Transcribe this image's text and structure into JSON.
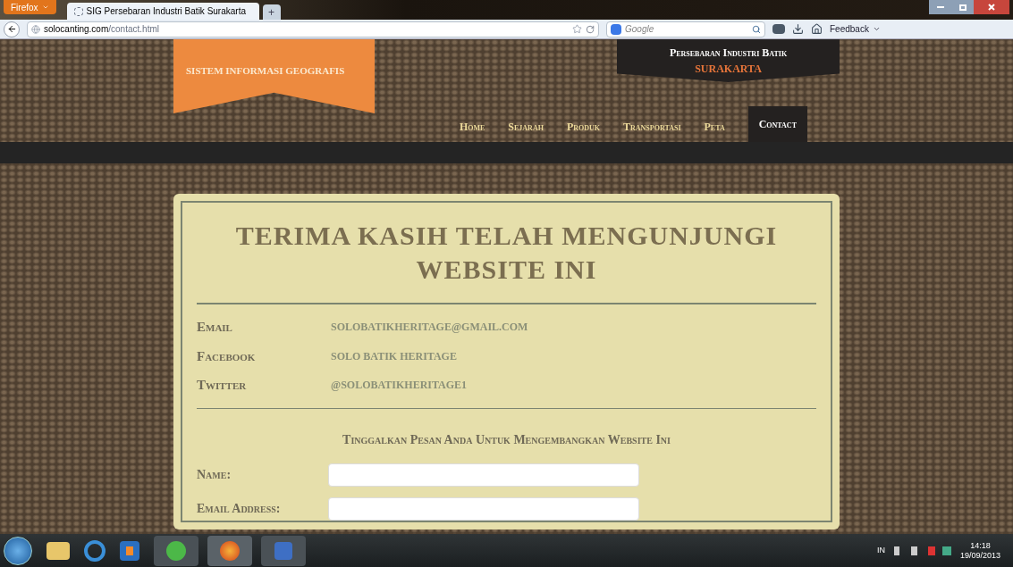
{
  "browser": {
    "menu_button": "Firefox",
    "tabs": [
      {
        "title": "SIG Persebaran Industri Batik Surakarta",
        "selected": true
      }
    ],
    "new_tab": "+",
    "url_host": "solocanting.com",
    "url_path": "/contact.html",
    "search_placeholder": "Google",
    "feedback": "Feedback"
  },
  "site": {
    "banner": "SISTEM INFORMASI GEOGRAFIS",
    "title_line1": "Persebaran Industri Batik",
    "title_line2": "SURAKARTA",
    "nav": [
      {
        "label": "Home",
        "selected": false
      },
      {
        "label": "Sejarah",
        "selected": false
      },
      {
        "label": "Produk",
        "selected": false
      },
      {
        "label": "Transportasi",
        "selected": false
      },
      {
        "label": "Peta",
        "selected": false
      },
      {
        "label": "Contact",
        "selected": true
      }
    ]
  },
  "card": {
    "heading": "TERIMA KASIH TELAH MENGUNJUNGI WEBSITE INI",
    "contacts": [
      {
        "label": "Email",
        "value": "SOLOBATIKHERITAGE@GMAIL.COM"
      },
      {
        "label": "Facebook",
        "value": "SOLO BATIK HERITAGE"
      },
      {
        "label": "Twitter",
        "value": "@SOLOBATIKHERITAGE1"
      }
    ],
    "form_heading": "Tinggalkan Pesan Anda Untuk Mengembangkan Website Ini",
    "fields": [
      {
        "label": "Name:"
      },
      {
        "label": "Email Address:"
      }
    ]
  },
  "taskbar": {
    "language": "IN",
    "time": "14:18",
    "date": "19/09/2013"
  }
}
